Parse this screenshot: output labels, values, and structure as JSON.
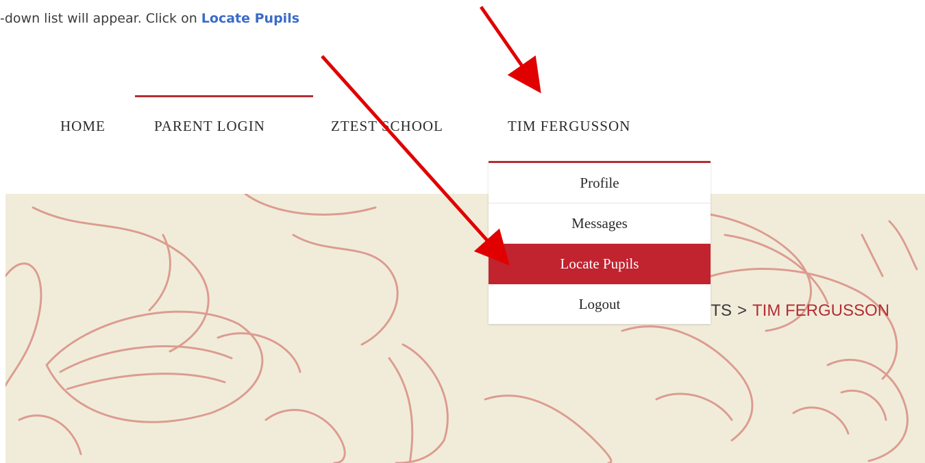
{
  "instruction": {
    "text_before": "-down list will appear.  Click on ",
    "emphasis": "Locate Pupils"
  },
  "nav": {
    "items": [
      {
        "label": "HOME"
      },
      {
        "label": "PARENT LOGIN"
      },
      {
        "label": "ZTEST SCHOOL"
      },
      {
        "label": "TIM FERGUSSON"
      }
    ],
    "active_item": "PARENT LOGIN"
  },
  "dropdown": {
    "items": [
      {
        "label": "Profile"
      },
      {
        "label": "Messages"
      },
      {
        "label": "Locate Pupils"
      },
      {
        "label": "Logout"
      }
    ],
    "highlighted_item": "Locate Pupils"
  },
  "breadcrumb": {
    "partial": "NTS",
    "separator": ">",
    "current": "TIM FERGUSSON"
  },
  "colors": {
    "accent_red": "#b32d33",
    "highlight_red": "#c1232f",
    "arrow_red": "#e00000",
    "instruction_blue": "#3a6bc9",
    "banner_bg": "#f1ecda",
    "sketch": "#d98f84"
  },
  "icons": {
    "annotation_arrows": "arrow-icon"
  }
}
